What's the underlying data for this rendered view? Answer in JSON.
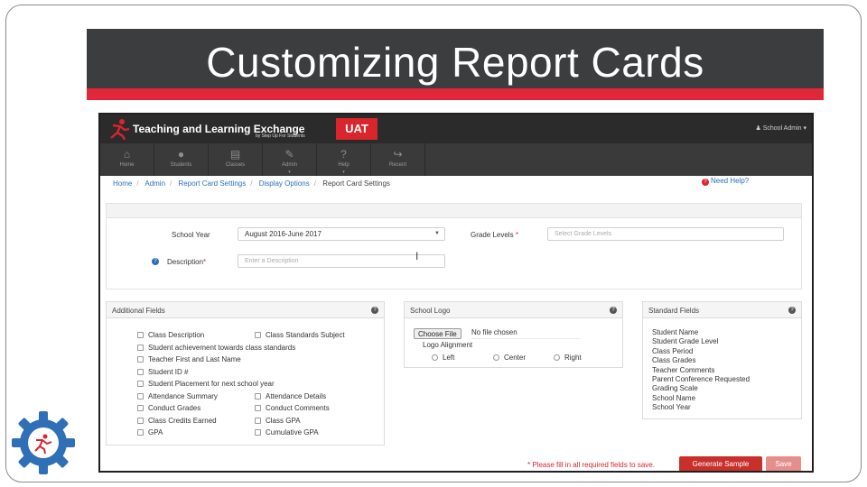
{
  "slide": {
    "title": "Customizing Report Cards"
  },
  "app": {
    "brand": "Teaching and Learning Exchange",
    "brand_sub": "by Step Up For Students",
    "env_badge": "UAT",
    "user_menu": "School Admin"
  },
  "nav": [
    {
      "label": "Home",
      "icon": "home-icon",
      "caret": ""
    },
    {
      "label": "Students",
      "icon": "user-icon",
      "caret": ""
    },
    {
      "label": "Classes",
      "icon": "book-icon",
      "caret": ""
    },
    {
      "label": "Admin",
      "icon": "wrench-icon",
      "caret": "▾"
    },
    {
      "label": "Help",
      "icon": "question-icon",
      "caret": "▾"
    },
    {
      "label": "Recent",
      "icon": "share-icon",
      "caret": ""
    }
  ],
  "breadcrumb": [
    "Home",
    "Admin",
    "Report Card Settings",
    "Display Options",
    "Report Card Settings"
  ],
  "need_help": "Need Help?",
  "form": {
    "school_year_label": "School Year",
    "school_year_value": "August 2016-June 2017",
    "grade_levels_label": "Grade Levels",
    "grade_levels_placeholder": "Select Grade Levels",
    "description_label": "Description",
    "description_placeholder": "Enter a Description",
    "required_mark": "*"
  },
  "additional_fields": {
    "title": "Additional Fields",
    "left": [
      "Class Description",
      "Student achievement towards class standards",
      "Teacher First and Last Name",
      "Student ID #",
      "Student Placement for next school year",
      "Attendance Summary",
      "Conduct Grades",
      "Class Credits Earned",
      "GPA"
    ],
    "right": [
      "Class Standards Subject",
      "Attendance Details",
      "Conduct Comments",
      "Class GPA",
      "Cumulative GPA"
    ]
  },
  "school_logo": {
    "title": "School Logo",
    "choose_file": "Choose File",
    "file_status": "No file chosen",
    "alignment_label": "Logo Alignment",
    "options": [
      "Left",
      "Center",
      "Right"
    ]
  },
  "standard_fields": {
    "title": "Standard Fields",
    "items": [
      "Student Name",
      "Student Grade Level",
      "Class Period",
      "Class Grades",
      "Teacher Comments",
      "Parent Conference Requested",
      "Grading Scale",
      "School Name",
      "School Year"
    ]
  },
  "footer": {
    "note": "* Please fill in all required fields to save.",
    "generate_label": "Generate Sample",
    "save_label": "Save"
  },
  "colors": {
    "accent_red": "#d9252c",
    "link_blue": "#2a6ebb",
    "banner_dark": "#3b3d3f",
    "gear_blue": "#2f6fb6"
  }
}
